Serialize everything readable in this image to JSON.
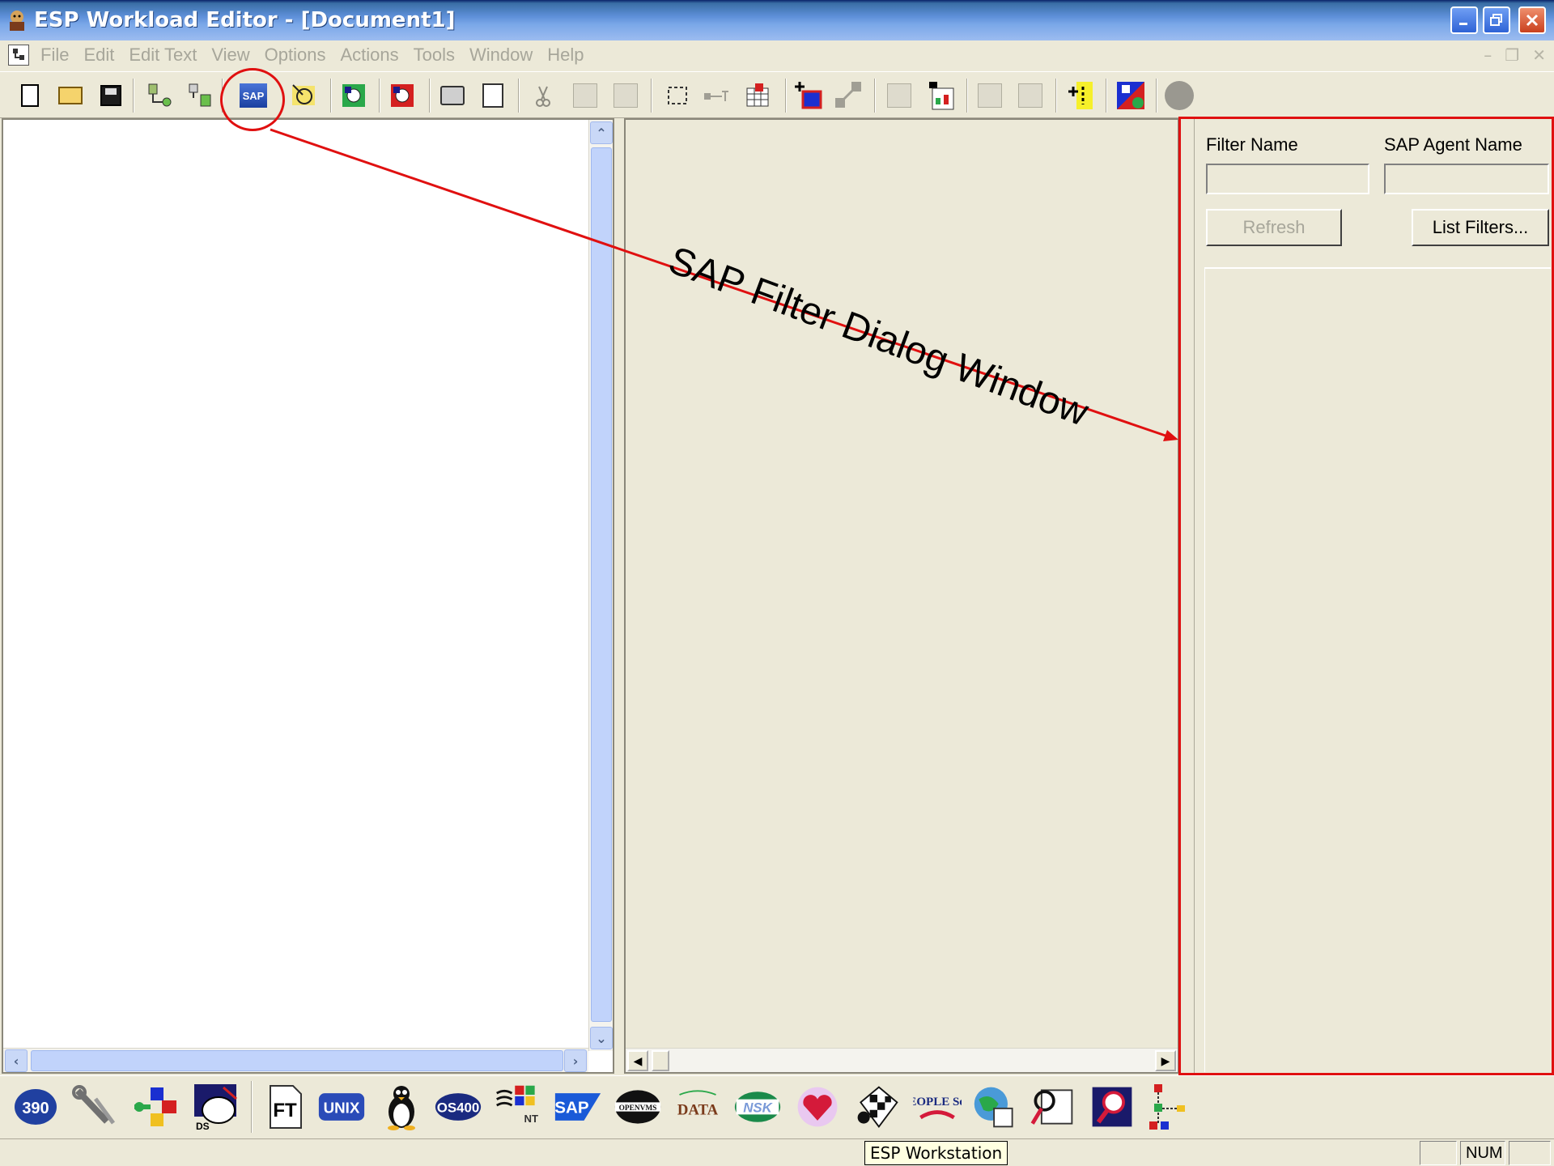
{
  "window": {
    "title": "ESP Workload Editor - [Document1]"
  },
  "menu": {
    "items": [
      "File",
      "Edit",
      "Edit Text",
      "View",
      "Options",
      "Actions",
      "Tools",
      "Window",
      "Help"
    ]
  },
  "toolbar": {
    "sap_icon_text": "SAP",
    "buttons": [
      "new-document-icon",
      "open-folder-icon",
      "save-disk-icon",
      "connect-icon",
      "disconnect-icon",
      "sap-filter-icon",
      "event-icon",
      "green-trigger-icon",
      "red-trigger-icon",
      "print-icon",
      "print-preview-icon",
      "cut-icon",
      "copy-icon",
      "paste-icon",
      "select-all-icon",
      "link-icon",
      "grid-icon",
      "add-job-icon",
      "connect-jobs-icon",
      "layout-icon",
      "tree-icon",
      "list-down-icon",
      "list-up-icon",
      "highlight-icon",
      "shapes-icon",
      "stop-icon"
    ]
  },
  "filter_panel": {
    "filter_name_label": "Filter Name",
    "agent_name_label": "SAP Agent Name",
    "filter_name_value": "",
    "agent_name_value": "",
    "refresh_label": "Refresh",
    "list_filters_label": "List Filters..."
  },
  "annotation": {
    "text": "SAP Filter Dialog Window",
    "color": "#e01010"
  },
  "agents": {
    "os390": "390",
    "ft": "FT",
    "unix": "UNIX",
    "os400": "OS400",
    "nt": "NT",
    "sap": "SAP",
    "openvms": "OPENVMS",
    "data": "DATA",
    "nsk": "NSK",
    "peoplesoft": "PEOPLE Soft",
    "ds": "DS"
  },
  "statusbar": {
    "tooltip": "ESP Workstation",
    "num": "NUM"
  }
}
